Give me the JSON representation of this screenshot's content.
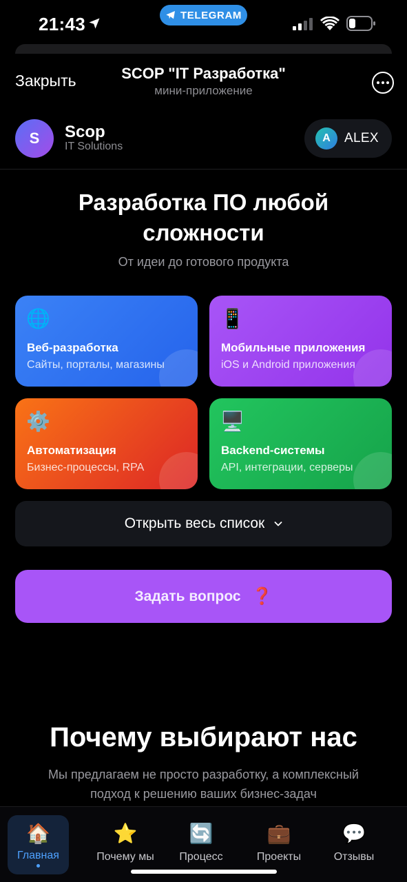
{
  "status_bar": {
    "time": "21:43",
    "telegram_badge": "TELEGRAM"
  },
  "tg_header": {
    "close_label": "Закрыть",
    "title": "SCOP \"IT Разработка\"",
    "subtitle": "мини-приложение"
  },
  "app_header": {
    "logo_letter": "S",
    "brand_name": "Scop",
    "brand_tagline": "IT Solutions",
    "user_initial": "A",
    "user_name": "ALEX"
  },
  "hero": {
    "title_line1": "Разработка ПО любой",
    "title_line2": "сложности",
    "subtitle": "От идеи до готового продукта"
  },
  "services": [
    {
      "icon": "🌐",
      "title": "Веб-разработка",
      "description": "Сайты, порталы, магазины",
      "color": "#3b82f6"
    },
    {
      "icon": "📱",
      "title": "Мобильные приложения",
      "description": "iOS и Android приложения",
      "color": "#a855f7"
    },
    {
      "icon": "⚙️",
      "title": "Автоматизация",
      "description": "Бизнес-процессы, RPA",
      "color": "#f97316"
    },
    {
      "icon": "🖥️",
      "title": "Backend-системы",
      "description": "API, интеграции, серверы",
      "color": "#22c55e"
    }
  ],
  "open_list_label": "Открыть весь список",
  "ask_button": {
    "label": "Задать вопрос",
    "icon": "❓"
  },
  "why": {
    "title": "Почему выбирают нас",
    "subtitle_line1": "Мы предлагаем не просто разработку, а комплексный",
    "subtitle_line2": "подход к решению ваших бизнес-задач"
  },
  "nav": [
    {
      "icon": "🏠",
      "label": "Главная"
    },
    {
      "icon": "⭐",
      "label": "Почему мы"
    },
    {
      "icon": "🔄",
      "label": "Процесс"
    },
    {
      "icon": "💼",
      "label": "Проекты"
    },
    {
      "icon": "💬",
      "label": "Отзывы"
    }
  ],
  "colors": {
    "accent": "#a855f7",
    "telegram": "#2f8fe6",
    "nav_active": "#4ea1ff"
  }
}
